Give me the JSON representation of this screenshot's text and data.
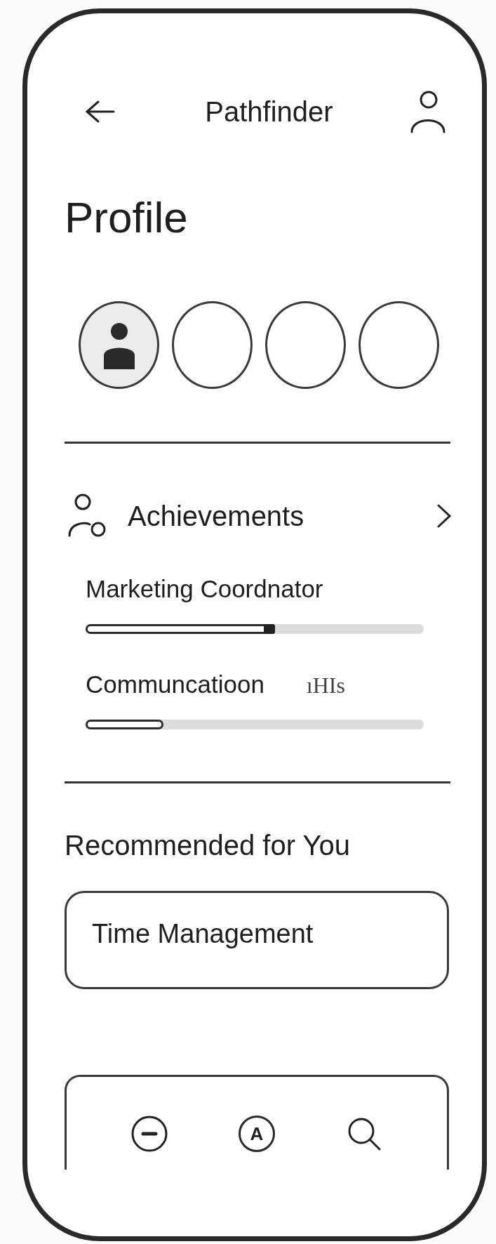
{
  "header": {
    "title": "Pathfinder"
  },
  "page_title": "Profile",
  "avatars": [
    {
      "selected": true
    },
    {
      "selected": false
    },
    {
      "selected": false
    },
    {
      "selected": false
    }
  ],
  "achievements": {
    "title": "Achievements",
    "items": [
      {
        "label": "Marketing Coordnator",
        "level": 0.56,
        "handle": true
      },
      {
        "label": "Communcatioon",
        "note": "ıHIs",
        "level": 0.23,
        "handle": false
      }
    ]
  },
  "recommended": {
    "title": "Recommended for You",
    "cards": [
      "Time Management"
    ]
  },
  "bottom_nav": [
    {
      "kind": "minus"
    },
    {
      "kind": "letter",
      "glyph": "A"
    },
    {
      "kind": "search"
    }
  ]
}
